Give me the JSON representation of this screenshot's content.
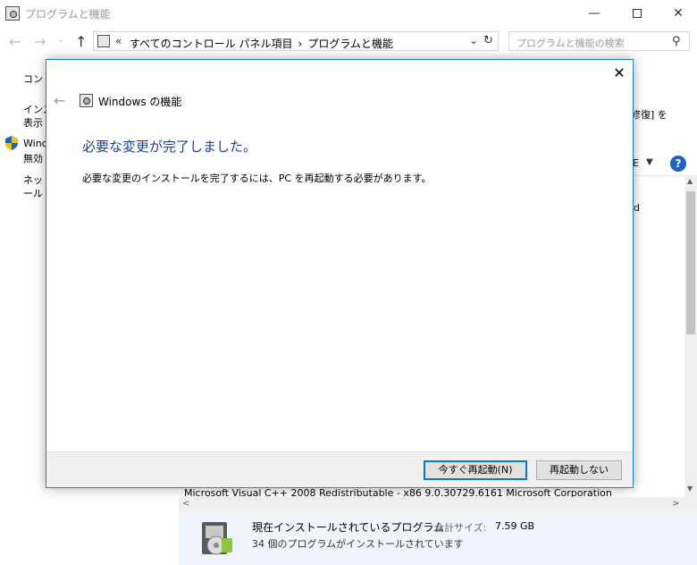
{
  "window": {
    "title": "プログラムと機能",
    "min": "—",
    "close": "✕"
  },
  "nav": {
    "back": "←",
    "forward": "→",
    "dropdown": "⌄",
    "up": "↑",
    "address_chevron": "«",
    "breadcrumb_1": "すべてのコントロール パネル項目",
    "breadcrumb_sep": "›",
    "breadcrumb_2": "プログラムと機能",
    "address_dropdown": "⌄",
    "refresh": "↻",
    "search_placeholder": "プログラムと機能の検索",
    "search_icon": "⚲"
  },
  "background": {
    "left_items": [
      "コント",
      "インス",
      "表示",
      "Winc",
      "無効",
      "ネット",
      "ール"
    ],
    "right_fragments": [
      "修復] を",
      "d",
      "E"
    ],
    "view_dropdown": "▼",
    "help": "?",
    "list_row": "Microsoft Visual C++ 2008 Redistributable - x86 9.0.30729.6161    Microsoft Corporation",
    "scroll_up": "▲",
    "scroll_down": "▼",
    "scroll_left": "<",
    "scroll_right": ">"
  },
  "details": {
    "title": "現在インストールされているプログラム",
    "size_label": "合計サイズ:",
    "size_value": "7.59 GB",
    "count_text": "34 個のプログラムがインストールされています"
  },
  "dialog": {
    "close": "✕",
    "back": "←",
    "app_name": "Windows の機能",
    "heading": "必要な変更が完了しました。",
    "message": "必要な変更のインストールを完了するには、PC を再起動する必要があります。",
    "restart_now": "今すぐ再起動(N)",
    "dont_restart": "再起動しない"
  },
  "colors": {
    "accent": "#0078d7",
    "heading": "#1a3e9a",
    "help": "#1e62c3"
  }
}
